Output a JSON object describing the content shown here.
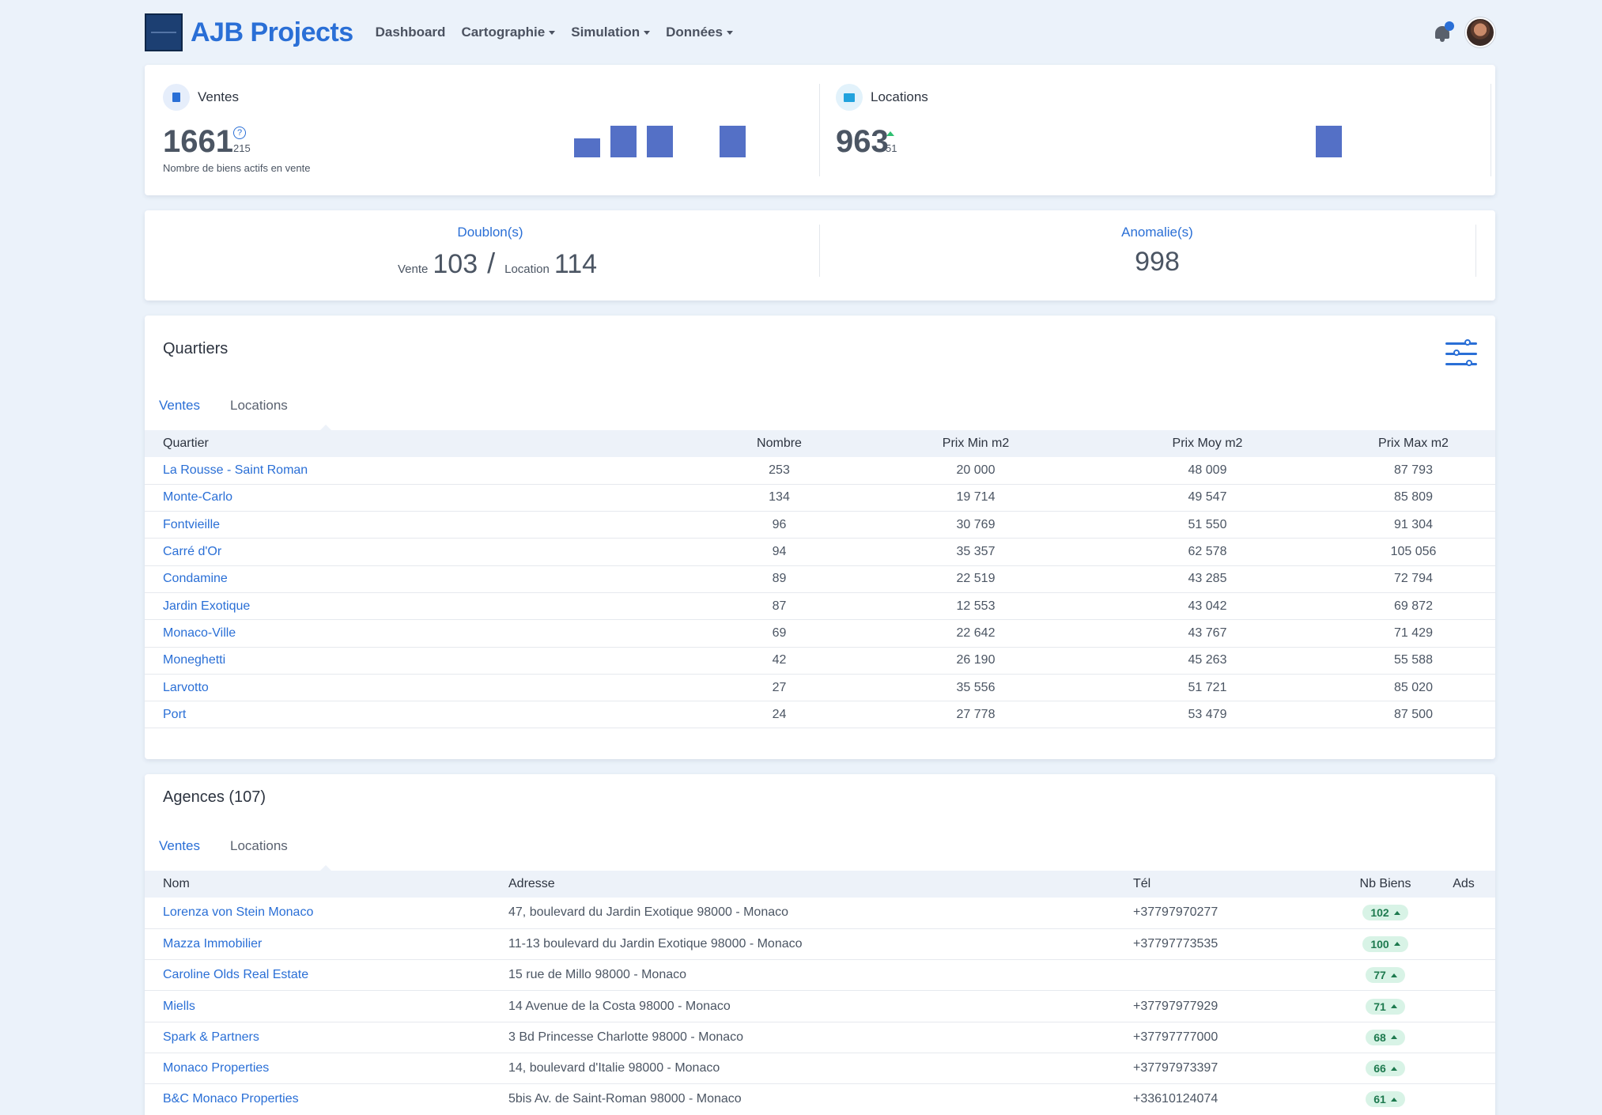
{
  "nav": {
    "brand": "AJB Projects",
    "items": [
      {
        "label": "Dashboard",
        "dropdown": false
      },
      {
        "label": "Cartographie",
        "dropdown": true
      },
      {
        "label": "Simulation",
        "dropdown": true
      },
      {
        "label": "Données",
        "dropdown": true
      }
    ],
    "icons": [
      "bell-icon",
      "avatar"
    ]
  },
  "stats": {
    "ventes": {
      "title": "Ventes",
      "value": "1661",
      "delta": "215",
      "label": "Nombre de biens actifs en vente",
      "help_icon": "?"
    },
    "locations": {
      "title": "Locations",
      "value": "963",
      "delta": "51"
    }
  },
  "sparklines": {
    "ventes": [
      0.6,
      1.0,
      1.0,
      0,
      1.0
    ],
    "locations": [
      1.0
    ]
  },
  "doublons": {
    "title": "Doublon(s)",
    "vente_label": "Vente",
    "vente_value": "103",
    "separator": "/",
    "location_label": "Location",
    "location_value": "114"
  },
  "anomalies": {
    "title": "Anomalie(s)",
    "value": "998"
  },
  "quartiers": {
    "title": "Quartiers",
    "tabs": [
      "Ventes",
      "Locations"
    ],
    "columns": [
      "Quartier",
      "Nombre",
      "Prix Min m2",
      "Prix Moy m2",
      "Prix Max m2"
    ],
    "rows": [
      [
        "La Rousse - Saint Roman",
        "253",
        "20 000",
        "48 009",
        "87 793"
      ],
      [
        "Monte-Carlo",
        "134",
        "19 714",
        "49 547",
        "85 809"
      ],
      [
        "Fontvieille",
        "96",
        "30 769",
        "51 550",
        "91 304"
      ],
      [
        "Carré d'Or",
        "94",
        "35 357",
        "62 578",
        "105 056"
      ],
      [
        "Condamine",
        "89",
        "22 519",
        "43 285",
        "72 794"
      ],
      [
        "Jardin Exotique",
        "87",
        "12 553",
        "43 042",
        "69 872"
      ],
      [
        "Monaco-Ville",
        "69",
        "22 642",
        "43 767",
        "71 429"
      ],
      [
        "Moneghetti",
        "42",
        "26 190",
        "45 263",
        "55 588"
      ],
      [
        "Larvotto",
        "27",
        "35 556",
        "51 721",
        "85 020"
      ],
      [
        "Port",
        "24",
        "27 778",
        "53 479",
        "87 500"
      ]
    ]
  },
  "agences": {
    "title": "Agences (107)",
    "tabs": [
      "Ventes",
      "Locations"
    ],
    "columns": [
      "Nom",
      "Adresse",
      "Tél",
      "Nb Biens",
      "Ads"
    ],
    "rows": [
      [
        "Lorenza von Stein Monaco",
        "47, boulevard du Jardin Exotique 98000 - Monaco",
        "+37797970277",
        "102",
        ""
      ],
      [
        "Mazza Immobilier",
        "11-13 boulevard du Jardin Exotique 98000 - Monaco",
        "+37797773535",
        "100",
        ""
      ],
      [
        "Caroline Olds Real Estate",
        "15 rue de Millo 98000 - Monaco",
        "",
        "77",
        ""
      ],
      [
        "Miells",
        "14 Avenue de la Costa 98000 - Monaco",
        "+37797977929",
        "71",
        ""
      ],
      [
        "Spark & Partners",
        "3 Bd Princesse Charlotte 98000 - Monaco",
        "+37797777000",
        "68",
        ""
      ],
      [
        "Monaco Properties",
        "14, boulevard d'Italie 98000 - Monaco",
        "+37797973397",
        "66",
        ""
      ],
      [
        "B&C Monaco Properties",
        "5bis Av. de Saint-Roman 98000 - Monaco",
        "+33610124074",
        "61",
        ""
      ]
    ]
  },
  "colors": {
    "accent": "#2a6fd6",
    "bars": "#5470c6",
    "background": "#ebf2fa",
    "badge_bg": "#d8f3e6",
    "badge_fg": "#1e7a4f",
    "up": "#2fbf71"
  }
}
